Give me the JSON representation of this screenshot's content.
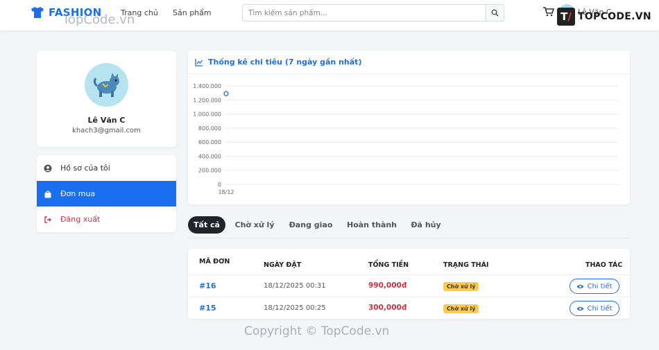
{
  "header": {
    "brand": "FASHION",
    "nav": [
      "Trang chủ",
      "Sản phẩm"
    ],
    "search_placeholder": "Tìm kiếm sản phẩm...",
    "user_name": "Lê Văn C"
  },
  "watermarks": {
    "top": "TopCode.vn",
    "logo": "TOPCODE.VN",
    "bottom": "Copyright © TopCode.vn"
  },
  "profile": {
    "name": "Lê Văn C",
    "email": "khach3@gmail.com"
  },
  "menu": [
    {
      "label": "Hồ sơ của tôi",
      "icon": "user-circle-icon",
      "active": false
    },
    {
      "label": "Đơn mua",
      "icon": "shopping-bag-icon",
      "active": true
    },
    {
      "label": "Đăng xuất",
      "icon": "sign-out-icon",
      "active": false
    }
  ],
  "chart": {
    "title": "Thống kê chi tiêu (7 ngày gần nhất)",
    "color": "#3b7be0"
  },
  "chart_data": {
    "type": "line",
    "title": "Thống kê chi tiêu (7 ngày gần nhất)",
    "categories": [
      "18/12"
    ],
    "series": [
      {
        "values": [
          1290000
        ]
      }
    ],
    "ylim": [
      0,
      1400000
    ],
    "yticks": [
      "1.400.000",
      "1.200.000",
      "1.000.000",
      "800.000",
      "600.000",
      "400.000",
      "200.000",
      "0"
    ],
    "grid": true
  },
  "tabs": [
    "Tất cả",
    "Chờ xử lý",
    "Đang giao",
    "Hoàn thành",
    "Đã hủy"
  ],
  "table": {
    "headers": [
      "MÃ ĐƠN",
      "NGÀY ĐẶT",
      "TỔNG TIỀN",
      "TRẠNG THÁI",
      "THAO TÁC"
    ],
    "rows": [
      {
        "code": "#16",
        "date": "18/12/2025 00:31",
        "total": "990,000đ",
        "status": "Chờ xử lý",
        "action": "Chi tiết"
      },
      {
        "code": "#15",
        "date": "18/12/2025 00:25",
        "total": "300,000đ",
        "status": "Chờ xử lý",
        "action": "Chi tiết"
      }
    ]
  },
  "colors": {
    "primary": "#1a6ef0",
    "danger": "#d62e3f",
    "warning": "#ffc94a"
  }
}
